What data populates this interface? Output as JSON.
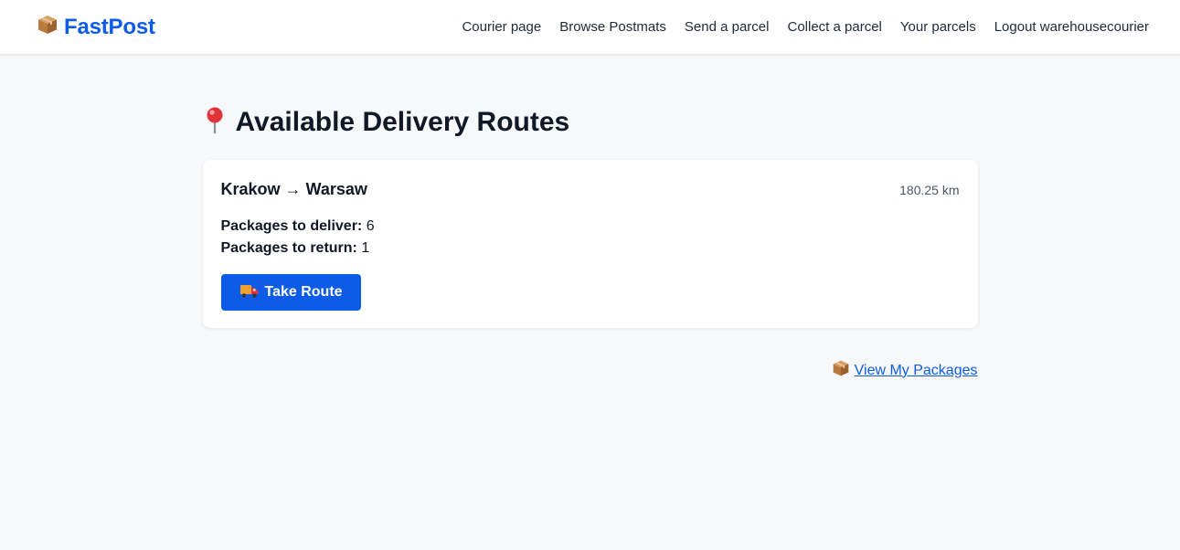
{
  "header": {
    "brand": "FastPost",
    "nav": [
      {
        "label": "Courier page"
      },
      {
        "label": "Browse Postmats"
      },
      {
        "label": "Send a parcel"
      },
      {
        "label": "Collect a parcel"
      },
      {
        "label": "Your parcels"
      },
      {
        "label": "Logout warehousecourier"
      }
    ]
  },
  "page": {
    "title": "Available Delivery Routes"
  },
  "routes": [
    {
      "name": "Krakow → Warsaw",
      "distance": "180.25 km",
      "deliver_label": "Packages to deliver:",
      "deliver_count": "6",
      "return_label": "Packages to return:",
      "return_count": "1",
      "button_label": "Take Route"
    }
  ],
  "footer": {
    "view_packages_label": "View My Packages"
  },
  "icons": {
    "brand": "package-icon",
    "title": "pin-icon",
    "take_route": "truck-icon",
    "view_packages": "package-icon"
  },
  "colors": {
    "accent": "#0d5ce8",
    "background": "#f7f8fa",
    "text": "#111827"
  }
}
